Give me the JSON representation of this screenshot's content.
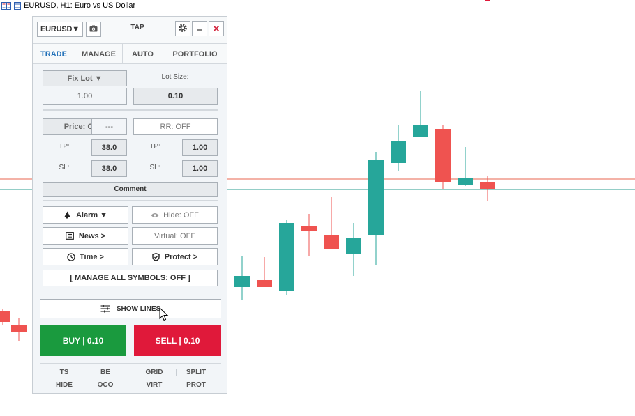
{
  "chart": {
    "title": "EURUSD, H1:  Euro vs US Dollar",
    "bull_color": "#26a69a",
    "bear_color": "#ef5350",
    "level_lines": [
      {
        "name": "red-level",
        "color": "#e8664f"
      },
      {
        "name": "teal-level",
        "color": "#2a9d8f"
      }
    ]
  },
  "panel": {
    "symbol": "EURUSD▼",
    "title": "TAP",
    "tabs": [
      "TRADE",
      "MANAGE",
      "AUTO",
      "PORTFOLIO"
    ],
    "active_tab": "TRADE",
    "lot_mode": "Fix Lot ▼",
    "lot_size_label": "Lot Size:",
    "lot_value": "1.00",
    "lot_size_value": "0.10",
    "price_toggle": "Price: OFF",
    "price_value": "---",
    "rr_toggle": "RR: OFF",
    "tp_label": "TP:",
    "sl_label": "SL:",
    "tp_price": "38.0",
    "sl_price": "38.0",
    "tp_rr": "1.00",
    "sl_rr": "1.00",
    "comment": "Comment",
    "alarm": "Alarm ▼",
    "hide": "Hide: OFF",
    "news": "News >",
    "virtual": "Virtual: OFF",
    "time": "Time >",
    "protect": "Protect >",
    "manage_all": "[ MANAGE ALL SYMBOLS: OFF ]",
    "show_lines": "SHOW LINES",
    "buy": "BUY | 0.10",
    "sell": "SELL | 0.10",
    "mini_row1": [
      "TS",
      "BE",
      "GRID",
      "SPLIT"
    ],
    "mini_row2": [
      "HIDE",
      "OCO",
      "VIRT",
      "PROT"
    ]
  }
}
